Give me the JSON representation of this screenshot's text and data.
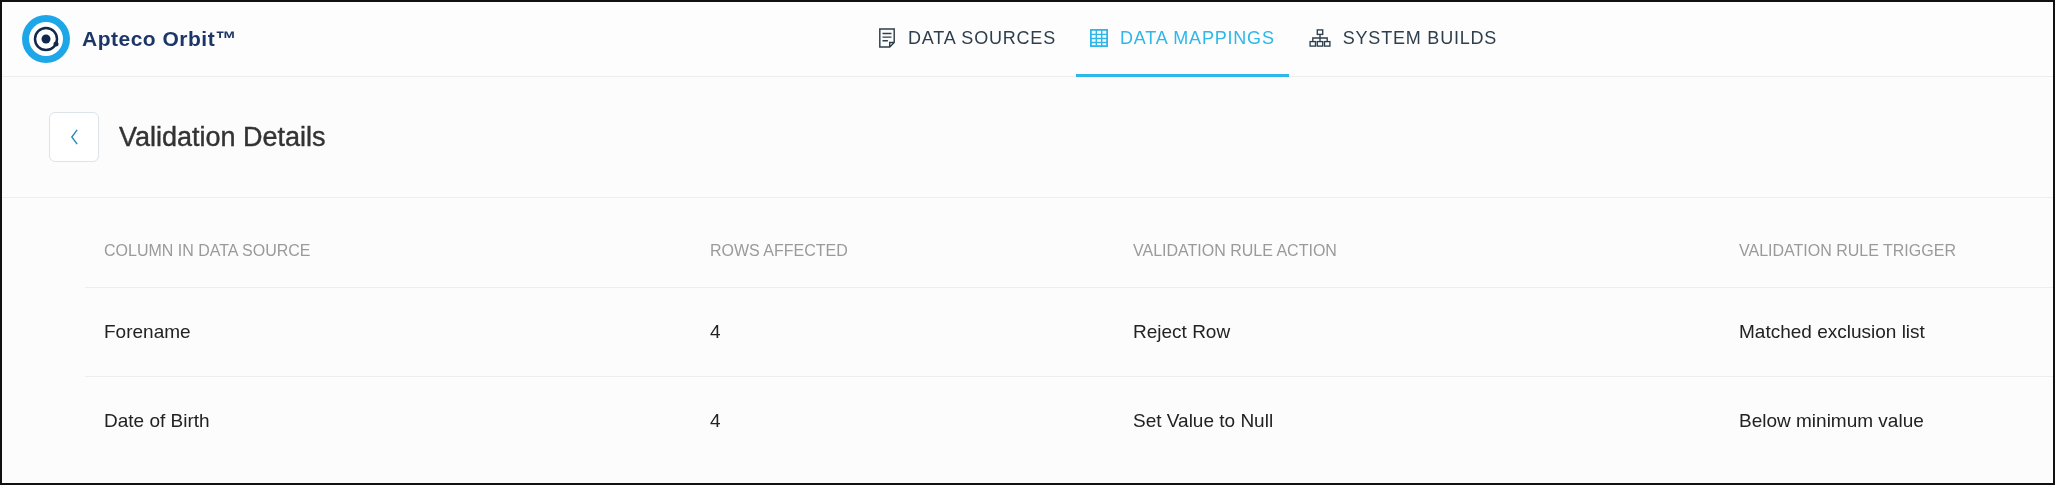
{
  "brand": {
    "name": "Apteco Orbit™"
  },
  "tabs": [
    {
      "label": "DATA SOURCES",
      "kind": "document",
      "selected": false
    },
    {
      "label": "DATA MAPPINGS",
      "kind": "table",
      "selected": true
    },
    {
      "label": "SYSTEM BUILDS",
      "kind": "hierarchy",
      "selected": false
    }
  ],
  "page": {
    "title": "Validation Details"
  },
  "table": {
    "columns": [
      "COLUMN IN DATA SOURCE",
      "ROWS AFFECTED",
      "VALIDATION RULE ACTION",
      "VALIDATION RULE TRIGGER"
    ],
    "rows": [
      [
        "Forename",
        "4",
        "Reject Row",
        "Matched exclusion list"
      ],
      [
        "Date of Birth",
        "4",
        "Set Value to Null",
        "Below minimum value"
      ]
    ]
  }
}
